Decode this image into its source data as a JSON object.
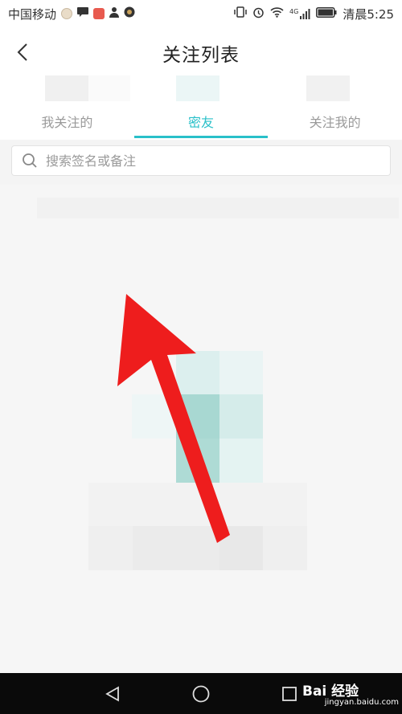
{
  "status_bar": {
    "carrier": "中国移动",
    "time": "清晨5:25",
    "network_label": "4G"
  },
  "header": {
    "title": "关注列表"
  },
  "tabs": [
    {
      "label": "我关注的",
      "active": false
    },
    {
      "label": "密友",
      "active": true
    },
    {
      "label": "关注我的",
      "active": false
    }
  ],
  "search": {
    "placeholder": "搜索签名或备注"
  },
  "colors": {
    "accent": "#29c0c9",
    "annotation_arrow": "#ee1d1d",
    "navbar": "#0a0a0a"
  },
  "watermark": {
    "brand": "Bai 经验",
    "url": "jingyan.baidu.com"
  }
}
